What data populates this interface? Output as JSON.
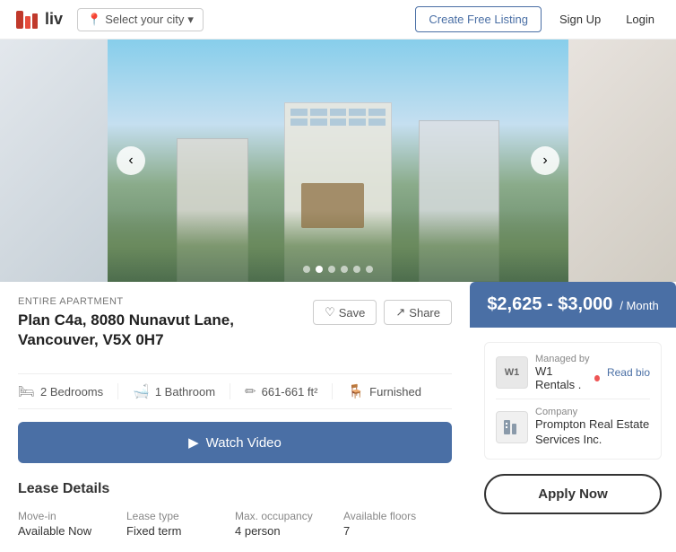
{
  "header": {
    "logo_text": "liv",
    "city_placeholder": "Select your city",
    "create_listing_label": "Create Free Listing",
    "signup_label": "Sign Up",
    "login_label": "Login"
  },
  "carousel": {
    "dots": [
      1,
      2,
      3,
      4,
      5,
      6
    ],
    "active_dot": 2
  },
  "listing": {
    "type": "ENTIRE APARTMENT",
    "title": "Plan C4a, 8080 Nunavut Lane, Vancouver, V5X 0H7",
    "save_label": "Save",
    "share_label": "Share",
    "amenities": [
      {
        "icon": "🛏",
        "text": "2 Bedrooms"
      },
      {
        "icon": "🛁",
        "text": "1 Bathroom"
      },
      {
        "icon": "✏",
        "text": "661-661 ft²"
      },
      {
        "icon": "🪑",
        "text": "Furnished"
      }
    ],
    "watch_video_label": "Watch Video",
    "lease_details_title": "Lease Details",
    "lease": {
      "move_in_label": "Move-in",
      "move_in_value": "Available Now",
      "lease_type_label": "Lease type",
      "lease_type_value": "Fixed term",
      "max_occupancy_label": "Max. occupancy",
      "max_occupancy_value": "4 person",
      "available_floors_label": "Available floors",
      "available_floors_value": "7"
    }
  },
  "sidebar": {
    "price_range": "$2,625 - $3,000",
    "price_period": "/ Month",
    "manager": {
      "managed_by_label": "Managed by",
      "name": "W1 Rentals .",
      "read_bio_label": "Read bio",
      "avatar_text": "W1"
    },
    "company": {
      "label": "Company",
      "name": "Prompton Real Estate Services Inc."
    },
    "apply_label": "Apply Now"
  }
}
